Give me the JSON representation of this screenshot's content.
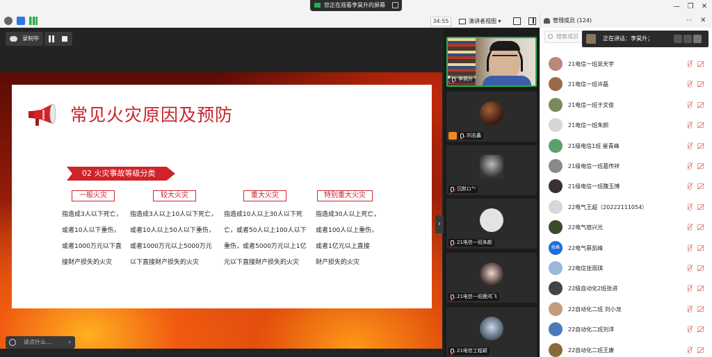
{
  "topbar": {
    "share_banner": "您正在观看李昊升的屏幕",
    "timer": "34:55",
    "view_mode": "演讲者视图",
    "view_mode_caret": "▾"
  },
  "stage": {
    "recording_label": "录制中",
    "chat_placeholder": "说点什么...",
    "chat_collapse": "‹",
    "side_toggle": "›"
  },
  "slide": {
    "title": "常见火灾原因及预防",
    "section": "02 火灾事故等级分类",
    "levels": [
      {
        "label": "一般火灾",
        "lines": [
          "指造成3人以下死亡，",
          "或者10人以下重伤，",
          "或者1000万元以下直",
          "接财产损失的火灾"
        ]
      },
      {
        "label": "较大火灾",
        "lines": [
          "指造成3人以上10人以下死亡，",
          "或者10人以上50人以下重伤，",
          "或者1000万元以上5000万元",
          "以下直接财产损失的火灾"
        ]
      },
      {
        "label": "重大火灾",
        "lines": [
          "指造成10人以上30人以下死",
          "亡，或者50人以上100人以下",
          "重伤，或者5000万元以上1亿",
          "元以下直接财产损失的火灾"
        ]
      },
      {
        "label": "特别重大火灾",
        "lines": [
          "指造成30人以上死亡，",
          "或者100人以上重伤，",
          "或者1亿元以上直接",
          "财产损失的火灾"
        ]
      }
    ]
  },
  "videos": [
    {
      "name": "李昊升"
    },
    {
      "name": "刘志鑫"
    },
    {
      "name": "沉默ロ°ᵃ"
    },
    {
      "name": "21电信一班朱颜"
    },
    {
      "name": "21电信一班鹿鸿飞"
    },
    {
      "name": "21电信工程颖"
    }
  ],
  "panel": {
    "title": "管理成员 (124)",
    "more": "···",
    "close": "✕",
    "search_placeholder": "搜索成员",
    "speaking": "正在讲话：李昊升；",
    "members": [
      {
        "name": "21电信一班吴天宇",
        "color": "#b8887a"
      },
      {
        "name": "21电信一班许磊",
        "color": "#9a6a4a"
      },
      {
        "name": "21电信一班于文俊",
        "color": "#7a8a5a"
      },
      {
        "name": "21电信一班朱颜",
        "color": "#d7d7d7"
      },
      {
        "name": "21级电信1班 崔青峰",
        "color": "#5aa06a"
      },
      {
        "name": "21级电信一班葛传祥",
        "color": "#8a8a8a"
      },
      {
        "name": "21级电信一班魏玉博",
        "color": "#3a3030"
      },
      {
        "name": "22电气王超（20222111054）",
        "color": "#d7d7d7"
      },
      {
        "name": "22电气宿兴光",
        "color": "#3a4a2a"
      },
      {
        "name": "22电气蔡凯峰",
        "color": "#1e6fd9",
        "badge": "凯峰"
      },
      {
        "name": "22电信张雨琪",
        "color": "#9ab8d8"
      },
      {
        "name": "22级自动化2班张进",
        "color": "#444"
      },
      {
        "name": "22自动化二班  刘小龙",
        "color": "#c79a7a"
      },
      {
        "name": "22自动化二班刘洋",
        "color": "#4a7ab8"
      },
      {
        "name": "22自动化二班王康",
        "color": "#8a6a3a"
      }
    ]
  },
  "colors": {
    "accent_red": "#d0232a",
    "active_green": "#22b14c"
  }
}
